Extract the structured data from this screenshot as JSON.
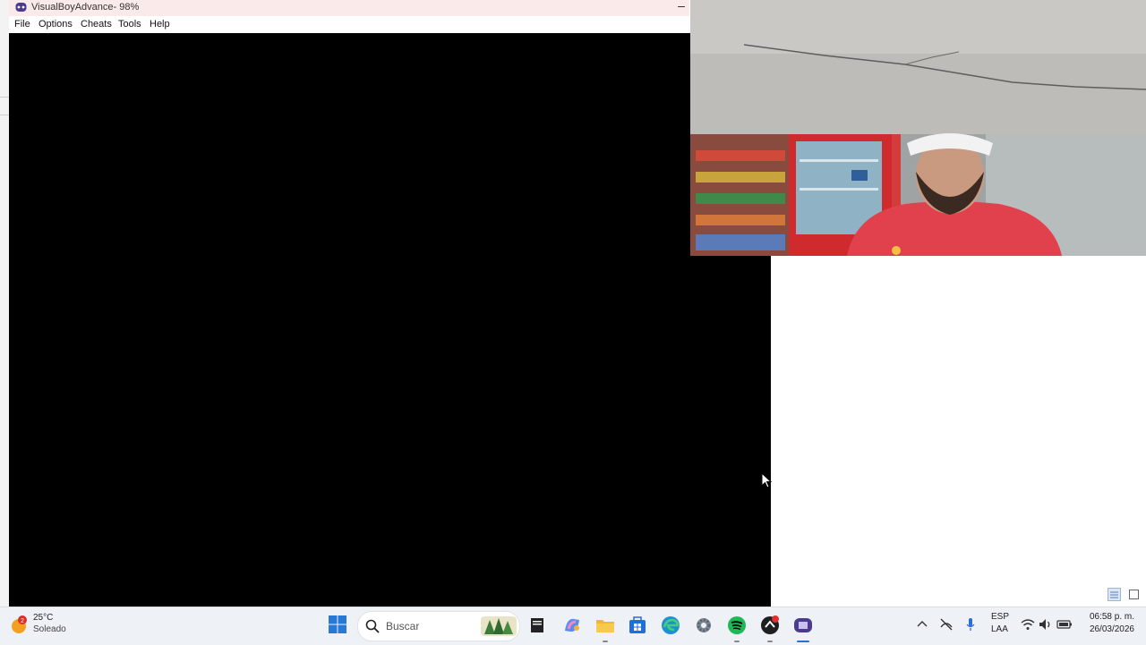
{
  "window": {
    "title": "VisualBoyAdvance- 98%",
    "minimize_glyph": "–",
    "menu": [
      "File",
      "Options",
      "Cheats",
      "Tools",
      "Help"
    ]
  },
  "taskbar": {
    "weather": {
      "temp": "25°C",
      "condition": "Soleado",
      "badge": "2"
    },
    "search_placeholder": "Buscar",
    "pinned_icons": [
      "file-explorer-icon",
      "copilot-icon",
      "folder-icon",
      "microsoft-store-icon",
      "edge-icon",
      "settings-icon",
      "spotify-icon",
      "game-app-icon",
      "visualboyadvance-icon"
    ],
    "language": {
      "primary": "ESP",
      "secondary": "LAA"
    },
    "clock": {
      "time": "06:58 p. m.",
      "date": "26/03/2026"
    }
  },
  "colors": {
    "title_bar": "#fbeaea",
    "emulator_screen": "#000000",
    "taskbar": "#eef1f6",
    "accent": "#2b6cd6"
  }
}
